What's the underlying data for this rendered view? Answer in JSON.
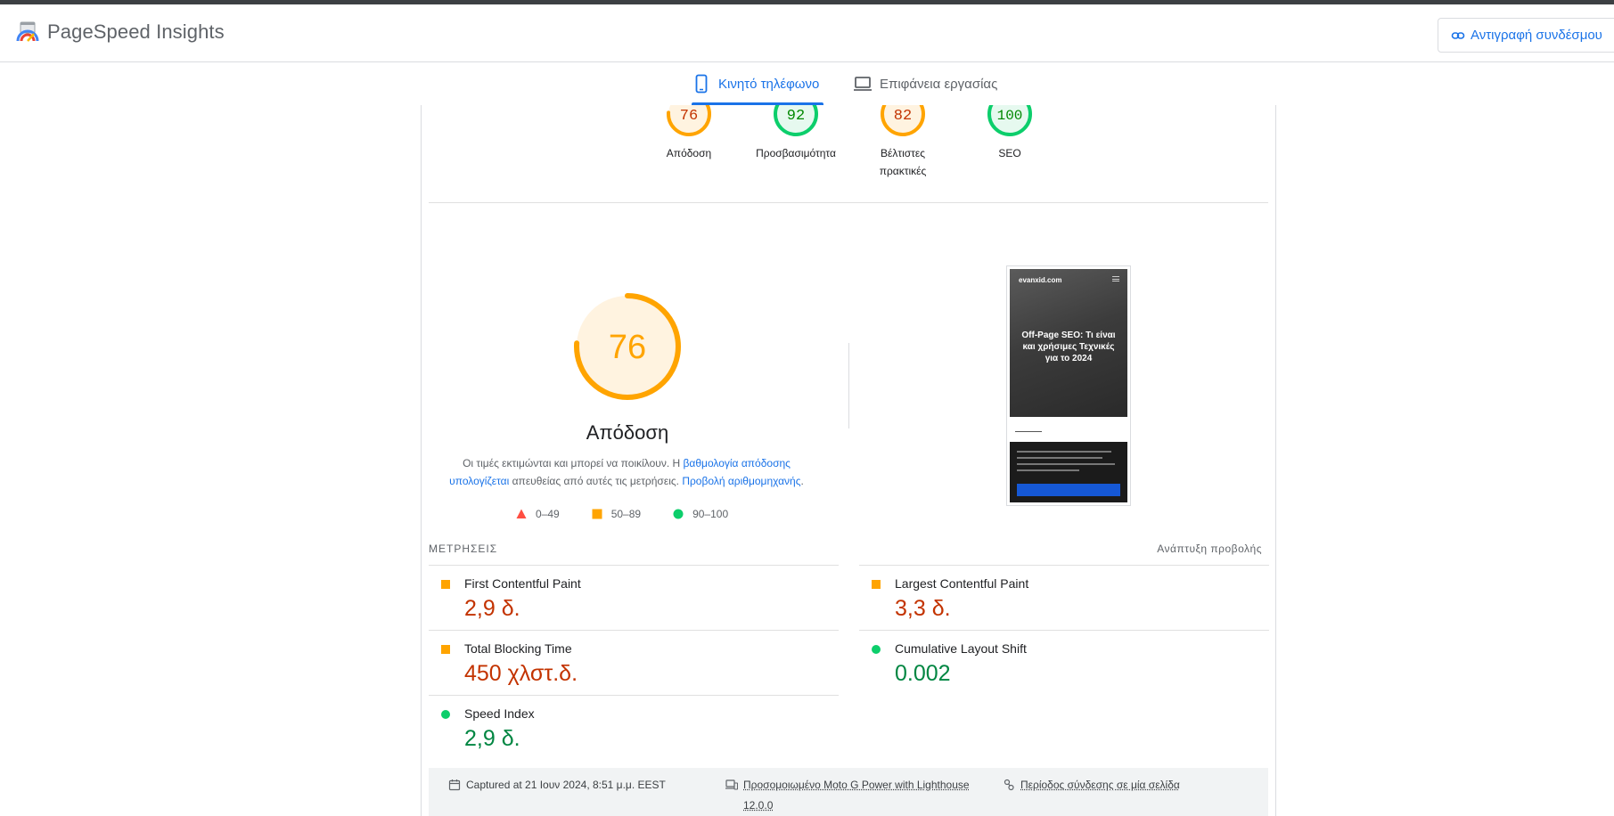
{
  "header": {
    "title": "PageSpeed Insights",
    "copy_link_label": "Αντιγραφή συνδέσμου"
  },
  "tabs": [
    {
      "label": "Κινητό τηλέφωνο",
      "icon": "smartphone-icon",
      "active": true
    },
    {
      "label": "Επιφάνεια εργασίας",
      "icon": "laptop-icon",
      "active": false
    }
  ],
  "categories": [
    {
      "score": "76",
      "label": "Απόδοση",
      "status": "average",
      "color": "#ffa400",
      "fraction": 0.76
    },
    {
      "score": "92",
      "label": "Προσβασιμότητα",
      "status": "pass",
      "color": "#0cce6b",
      "fraction": 0.92
    },
    {
      "score": "82",
      "label_line1": "Βέλτιστες",
      "label_line2": "πρακτικές",
      "status": "average",
      "color": "#ffa400",
      "fraction": 0.82
    },
    {
      "score": "100",
      "label": "SEO",
      "status": "pass",
      "color": "#0cce6b",
      "fraction": 1.0
    }
  ],
  "performance": {
    "score": "76",
    "fraction": 0.76,
    "title": "Απόδοση",
    "desc_part1": "Οι τιμές εκτιμώνται και μπορεί να ποικίλουν. Η ",
    "desc_link1": "βαθμολογία απόδοσης υπολογίζεται",
    "desc_part2": " απευθείας από αυτές τις μετρήσεις. ",
    "desc_link2": "Προβολή αριθμομηχανής",
    "desc_part3": "."
  },
  "legend": [
    {
      "range": "0–49",
      "shape": "triangle",
      "color": "#ff4e42"
    },
    {
      "range": "50–89",
      "shape": "square",
      "color": "#ffa400"
    },
    {
      "range": "90–100",
      "shape": "circle",
      "color": "#0cce6b"
    }
  ],
  "screenshot": {
    "site": "evanxid.com",
    "heading": "Off-Page SEO: Τι είναι και χρήσιμες Τεχνικές για το 2024"
  },
  "metrics_section": {
    "label": "ΜΕΤΡΗΣΕΙΣ",
    "expand_label": "Ανάπτυξη προβολής"
  },
  "metrics": [
    {
      "name": "First Contentful Paint",
      "value": "2,9 δ.",
      "status": "average"
    },
    {
      "name": "Largest Contentful Paint",
      "value": "3,3 δ.",
      "status": "average"
    },
    {
      "name": "Total Blocking Time",
      "value": "450 χλστ.δ.",
      "status": "average"
    },
    {
      "name": "Cumulative Layout Shift",
      "value": "0.002",
      "status": "pass"
    },
    {
      "name": "Speed Index",
      "value": "2,9 δ.",
      "status": "pass"
    }
  ],
  "footer": {
    "captured": "Captured at 21 Ιουν 2024, 8:51 μ.μ. EEST",
    "device_line1": "Προσομοιωμένο Moto G Power with Lighthouse",
    "device_line2": "12.0.0",
    "session": "Περίοδος σύνδεσης σε μία σελίδα"
  }
}
